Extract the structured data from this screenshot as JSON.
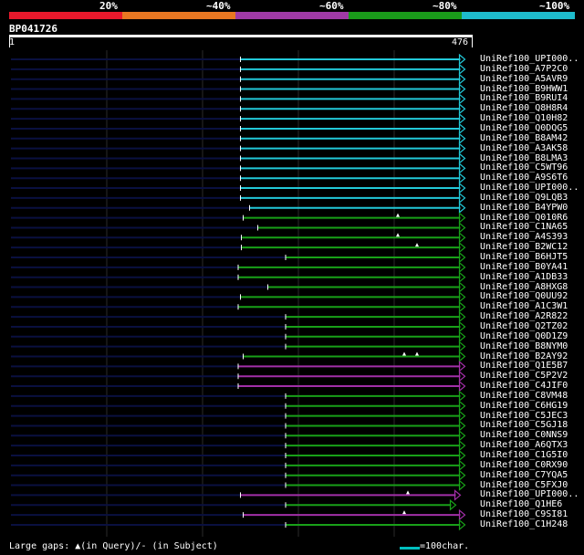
{
  "legend": [
    {
      "label": "20%",
      "color": "#e8192c"
    },
    {
      "label": "~40%",
      "color": "#e87722"
    },
    {
      "label": "~60%",
      "color": "#a03aa6"
    },
    {
      "label": "~80%",
      "color": "#1a9a1a"
    },
    {
      "label": "~100%",
      "color": "#1ebccc"
    }
  ],
  "query": {
    "name": "BP041726",
    "start": "1",
    "end": "476"
  },
  "colors": {
    "cyan": "#22c8d8",
    "green": "#18a018",
    "purple": "#a22fa8",
    "navy": "#0a1040",
    "grid": "#2a2a2a",
    "marker": "#ffffff"
  },
  "hits": [
    {
      "name": "UniRef100_UPI000..",
      "color": "cyan",
      "start": 0.503,
      "end": 0.995,
      "arrow": true
    },
    {
      "name": "UniRef100_A7P2C0",
      "color": "cyan",
      "start": 0.503,
      "end": 0.995,
      "arrow": true
    },
    {
      "name": "UniRef100_A5AVR9",
      "color": "cyan",
      "start": 0.503,
      "end": 0.995,
      "arrow": true
    },
    {
      "name": "UniRef100_B9HWW1",
      "color": "cyan",
      "start": 0.503,
      "end": 0.995,
      "arrow": true
    },
    {
      "name": "UniRef100_B9RUI4",
      "color": "cyan",
      "start": 0.503,
      "end": 0.995,
      "arrow": true
    },
    {
      "name": "UniRef100_Q8H8R4",
      "color": "cyan",
      "start": 0.503,
      "end": 0.995,
      "arrow": true
    },
    {
      "name": "UniRef100_Q10H82",
      "color": "cyan",
      "start": 0.503,
      "end": 0.995,
      "arrow": true
    },
    {
      "name": "UniRef100_Q0DQG5",
      "color": "cyan",
      "start": 0.503,
      "end": 0.995,
      "arrow": true
    },
    {
      "name": "UniRef100_B8AM42",
      "color": "cyan",
      "start": 0.503,
      "end": 0.995,
      "arrow": true
    },
    {
      "name": "UniRef100_A3AK58",
      "color": "cyan",
      "start": 0.503,
      "end": 0.995,
      "arrow": true
    },
    {
      "name": "UniRef100_B8LMA3",
      "color": "cyan",
      "start": 0.503,
      "end": 0.995,
      "arrow": true
    },
    {
      "name": "UniRef100_C5WT96",
      "color": "cyan",
      "start": 0.503,
      "end": 0.995,
      "arrow": true
    },
    {
      "name": "UniRef100_A9S6T6",
      "color": "cyan",
      "start": 0.503,
      "end": 0.995,
      "arrow": true
    },
    {
      "name": "UniRef100_UPI000..",
      "color": "cyan",
      "start": 0.503,
      "end": 0.995,
      "arrow": true
    },
    {
      "name": "UniRef100_Q9LQB3",
      "color": "cyan",
      "start": 0.503,
      "end": 0.995,
      "arrow": true
    },
    {
      "name": "UniRef100_B4YPW0",
      "color": "cyan",
      "start": 0.523,
      "end": 0.995,
      "arrow": true
    },
    {
      "name": "UniRef100_Q010R6",
      "color": "green",
      "start": 0.509,
      "end": 0.995,
      "arrow": true,
      "markers": [
        0.848
      ]
    },
    {
      "name": "UniRef100_C1NA65",
      "color": "green",
      "start": 0.541,
      "end": 0.995,
      "arrow": true
    },
    {
      "name": "UniRef100_A4S393",
      "color": "green",
      "start": 0.505,
      "end": 0.995,
      "arrow": true,
      "markers": [
        0.848
      ]
    },
    {
      "name": "UniRef100_B2WC12",
      "color": "green",
      "start": 0.505,
      "end": 0.995,
      "arrow": true,
      "markers": [
        0.89
      ]
    },
    {
      "name": "UniRef100_B6HJT5",
      "color": "green",
      "start": 0.602,
      "end": 0.995,
      "arrow": true
    },
    {
      "name": "UniRef100_B0YA41",
      "color": "green",
      "start": 0.498,
      "end": 0.995,
      "arrow": true
    },
    {
      "name": "UniRef100_A1DB33",
      "color": "green",
      "start": 0.498,
      "end": 0.995,
      "arrow": true
    },
    {
      "name": "UniRef100_A8HXG8",
      "color": "green",
      "start": 0.563,
      "end": 0.995,
      "arrow": true
    },
    {
      "name": "UniRef100_Q0UU92",
      "color": "green",
      "start": 0.503,
      "end": 0.995,
      "arrow": true
    },
    {
      "name": "UniRef100_A1C3W1",
      "color": "green",
      "start": 0.498,
      "end": 0.995,
      "arrow": true
    },
    {
      "name": "UniRef100_A2R822",
      "color": "green",
      "start": 0.602,
      "end": 0.995,
      "arrow": true
    },
    {
      "name": "UniRef100_Q2TZ02",
      "color": "green",
      "start": 0.602,
      "end": 0.995,
      "arrow": true
    },
    {
      "name": "UniRef100_Q0D1Z9",
      "color": "green",
      "start": 0.602,
      "end": 0.995,
      "arrow": true
    },
    {
      "name": "UniRef100_B8NYM0",
      "color": "green",
      "start": 0.602,
      "end": 0.995,
      "arrow": true
    },
    {
      "name": "UniRef100_B2AY92",
      "color": "green",
      "start": 0.509,
      "end": 0.995,
      "arrow": true,
      "markers": [
        0.862,
        0.89
      ]
    },
    {
      "name": "UniRef100_Q1E5B7",
      "color": "purple",
      "start": 0.498,
      "end": 0.995,
      "arrow": true
    },
    {
      "name": "UniRef100_C5P2V2",
      "color": "purple",
      "start": 0.498,
      "end": 0.995,
      "arrow": true
    },
    {
      "name": "UniRef100_C4JIF0",
      "color": "purple",
      "start": 0.498,
      "end": 0.995,
      "arrow": true
    },
    {
      "name": "UniRef100_C8VM48",
      "color": "green",
      "start": 0.602,
      "end": 0.995,
      "arrow": true
    },
    {
      "name": "UniRef100_C6HG19",
      "color": "green",
      "start": 0.602,
      "end": 0.995,
      "arrow": true
    },
    {
      "name": "UniRef100_C5JEC3",
      "color": "green",
      "start": 0.602,
      "end": 0.995,
      "arrow": true
    },
    {
      "name": "UniRef100_C5GJ18",
      "color": "green",
      "start": 0.602,
      "end": 0.995,
      "arrow": true
    },
    {
      "name": "UniRef100_C0NNS9",
      "color": "green",
      "start": 0.602,
      "end": 0.995,
      "arrow": true
    },
    {
      "name": "UniRef100_A6QTX3",
      "color": "green",
      "start": 0.602,
      "end": 0.995,
      "arrow": true
    },
    {
      "name": "UniRef100_C1G5I0",
      "color": "green",
      "start": 0.602,
      "end": 0.995,
      "arrow": true
    },
    {
      "name": "UniRef100_C0RX90",
      "color": "green",
      "start": 0.602,
      "end": 0.995,
      "arrow": true
    },
    {
      "name": "UniRef100_C7YQA5",
      "color": "green",
      "start": 0.602,
      "end": 0.995,
      "arrow": true
    },
    {
      "name": "UniRef100_C5FXJ0",
      "color": "green",
      "start": 0.602,
      "end": 0.995,
      "arrow": true
    },
    {
      "name": "UniRef100_UPI000..",
      "color": "purple",
      "start": 0.503,
      "end": 0.985,
      "arrow": true,
      "markers": [
        0.87
      ]
    },
    {
      "name": "UniRef100_Q1HE6",
      "color": "green",
      "start": 0.602,
      "end": 0.975,
      "arrow": true
    },
    {
      "name": "UniRef100_C9SI81",
      "color": "purple",
      "start": 0.509,
      "end": 0.995,
      "arrow": true,
      "markers": [
        0.862
      ]
    },
    {
      "name": "UniRef100_C1H248",
      "color": "green",
      "start": 0.602,
      "end": 0.995,
      "arrow": true
    }
  ],
  "footer": {
    "gaps_label": "Large gaps: ▲(in Query)/- (in Subject)",
    "scale_label": "=100char."
  }
}
